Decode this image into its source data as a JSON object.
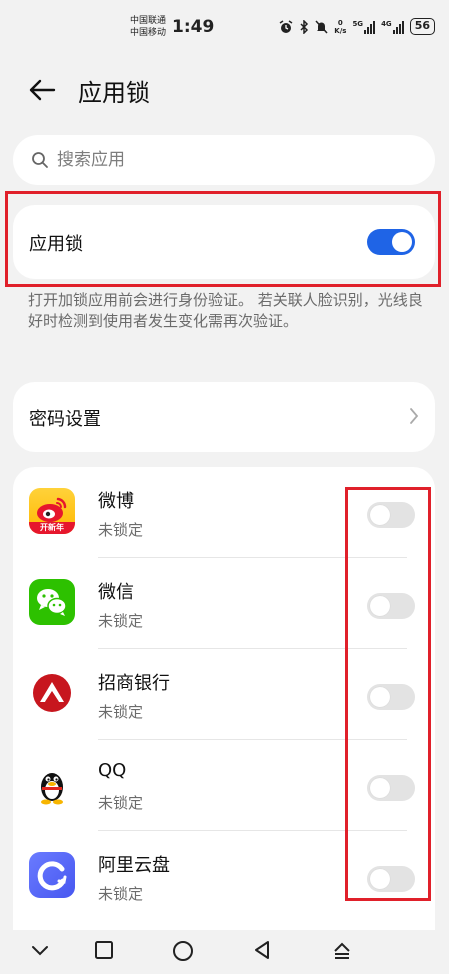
{
  "status_bar": {
    "carrier1": "中国联通",
    "carrier2": "中国移动",
    "time": "1:49",
    "speed_value": "0",
    "speed_unit": "K/s",
    "net1": "5G",
    "net2": "4G",
    "battery": "56"
  },
  "header": {
    "title": "应用锁"
  },
  "search": {
    "placeholder": "搜索应用"
  },
  "app_lock": {
    "label": "应用锁",
    "enabled": true,
    "accent": "#1f64e6"
  },
  "description": "打开加锁应用前会进行身份验证。 若关联人脸识别，光线良好时检测到使用者发生变化需再次验证。",
  "password_settings": {
    "label": "密码设置"
  },
  "apps": [
    {
      "name": "微博",
      "status": "未锁定",
      "locked": false,
      "icon": "weibo-icon"
    },
    {
      "name": "微信",
      "status": "未锁定",
      "locked": false,
      "icon": "wechat-icon"
    },
    {
      "name": "招商银行",
      "status": "未锁定",
      "locked": false,
      "icon": "cmb-icon"
    },
    {
      "name": "QQ",
      "status": "未锁定",
      "locked": false,
      "icon": "qq-icon"
    },
    {
      "name": "阿里云盘",
      "status": "未锁定",
      "locked": false,
      "icon": "aliyun-drive-icon"
    }
  ],
  "weibo_badge": "开新年",
  "highlight_color": "#e0202a"
}
